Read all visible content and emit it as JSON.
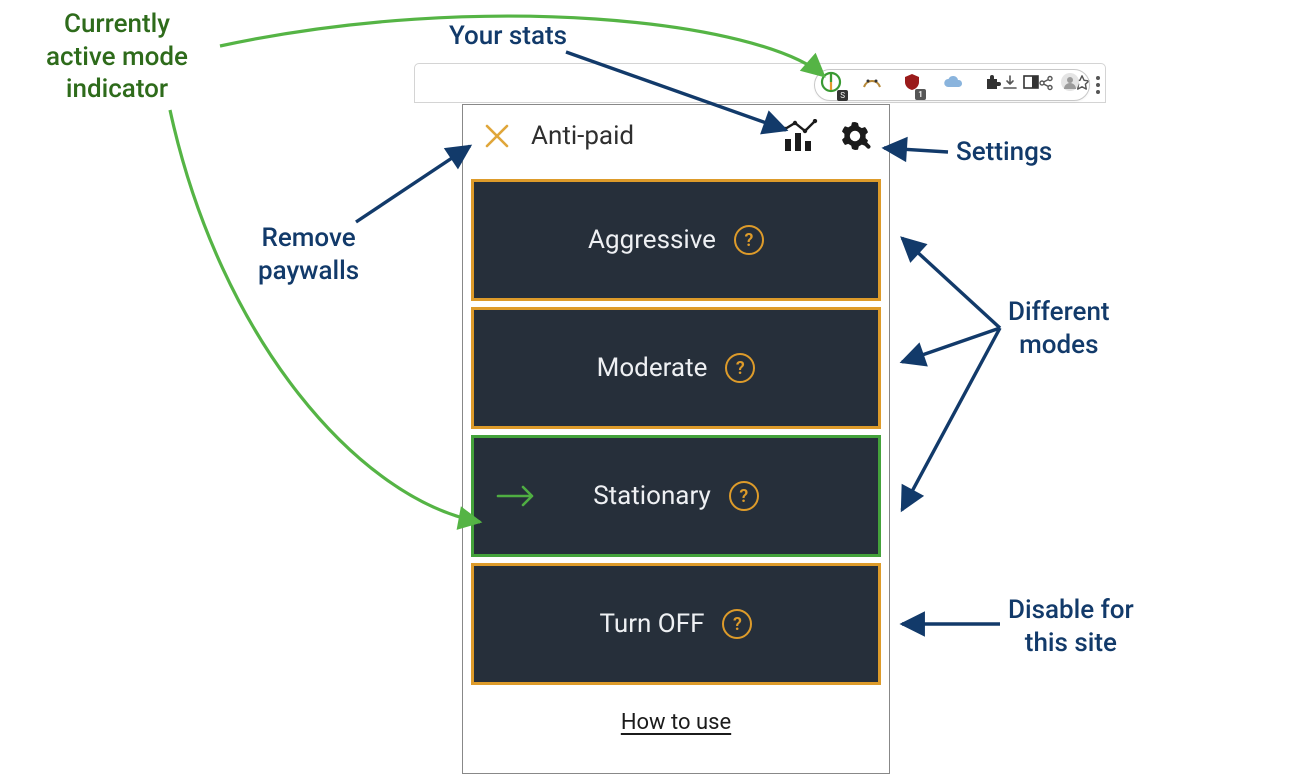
{
  "callouts": {
    "active_mode_indicator": "Currently\nactive mode\nindicator",
    "your_stats": "Your stats",
    "settings": "Settings",
    "remove_paywalls": "Remove\npaywalls",
    "different_modes": "Different\nmodes",
    "disable_site": "Disable for\nthis site"
  },
  "browser_toolbar": {
    "icons": [
      "download",
      "share",
      "star",
      "extension-current",
      "extension-secondary",
      "shield",
      "cloud",
      "puzzle",
      "panel",
      "profile",
      "menu"
    ],
    "shield_badge": "1"
  },
  "popup": {
    "title": "Anti-paid",
    "header_icons": {
      "close": "X",
      "stats": "stats-icon",
      "settings": "gear-icon"
    },
    "modes": [
      {
        "label": "Aggressive",
        "active": false,
        "border": "orange"
      },
      {
        "label": "Moderate",
        "active": false,
        "border": "orange"
      },
      {
        "label": "Stationary",
        "active": true,
        "border": "green"
      },
      {
        "label": "Turn OFF",
        "active": false,
        "border": "orange"
      }
    ],
    "help_glyph": "?",
    "footer_link": "How to use"
  }
}
